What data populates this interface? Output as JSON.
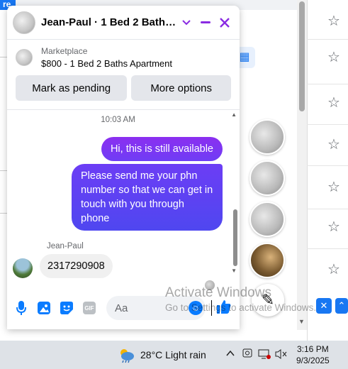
{
  "chat": {
    "title": "Jean-Paul · 1 Bed 2 Baths A...",
    "listing": {
      "label": "Marketplace",
      "title": "$800 - 1 Bed 2 Baths Apartment"
    },
    "buttons": {
      "mark_pending": "Mark as pending",
      "more_options": "More options"
    },
    "timestamp": "10:03 AM",
    "messages_out": [
      "Hi, this is still available",
      "Please send me your phn number so that we can get in touch with you through phone"
    ],
    "sender_name": "Jean-Paul",
    "message_in": "2317290908",
    "composer": {
      "placeholder": "Aa"
    },
    "icons": [
      "mic-icon",
      "image-icon",
      "sticker-icon",
      "gif-icon",
      "emoji-icon",
      "like-icon"
    ]
  },
  "watermark": {
    "line1": "Activate Windows",
    "line2": "Go to Settings to activate Windows."
  },
  "taskbar": {
    "weather": "28°C  Light rain",
    "time": "3:16 PM",
    "date": "9/3/2025"
  },
  "colors": {
    "accent": "#8a2be2",
    "bubble_out": "#7b35f2",
    "messenger_blue": "#0a7cff",
    "facebook_blue": "#1877f2"
  }
}
